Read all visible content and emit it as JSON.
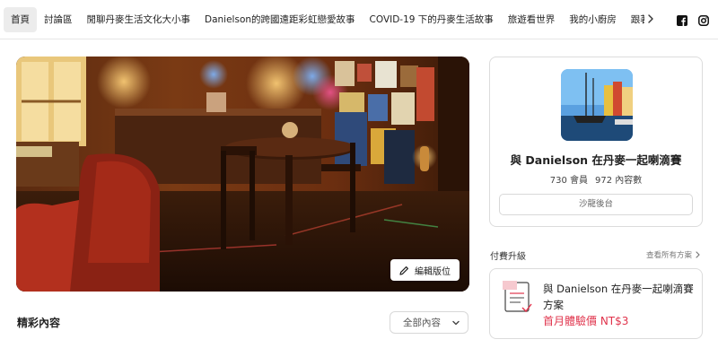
{
  "nav": {
    "tabs": [
      {
        "label": "首頁",
        "active": true
      },
      {
        "label": "討論區"
      },
      {
        "label": "閒聊丹麥生活文化大小事"
      },
      {
        "label": "Danielson的跨國遠距彩虹戀愛故事"
      },
      {
        "label": "COVID-19 下的丹麥生活故事"
      },
      {
        "label": "旅遊看世界"
      },
      {
        "label": "我的小廚房"
      },
      {
        "label": "跟著 Da"
      }
    ],
    "chevron_icon": "chevron-right-icon",
    "social": [
      "facebook-icon",
      "instagram-icon"
    ]
  },
  "hero": {
    "edit_button_label": "編輯版位",
    "edit_icon": "pencil-icon"
  },
  "content": {
    "section_title": "精彩內容",
    "filter": {
      "selected": "全部內容"
    }
  },
  "group": {
    "name": "與 Danielson 在丹麥一起喇滴賽",
    "members": "730 會員",
    "posts": "972 內容數",
    "admin_button": "沙龍後台"
  },
  "upgrade": {
    "label": "付費升級",
    "view_all": "查看所有方案",
    "plan": {
      "name": "與 Danielson 在丹麥一起喇滴賽方案",
      "price": "首月體驗價 NT$3"
    }
  },
  "colors": {
    "price_red": "#e0344c",
    "active_tab_bg": "#ececec",
    "card_border": "#dcdcdc"
  }
}
